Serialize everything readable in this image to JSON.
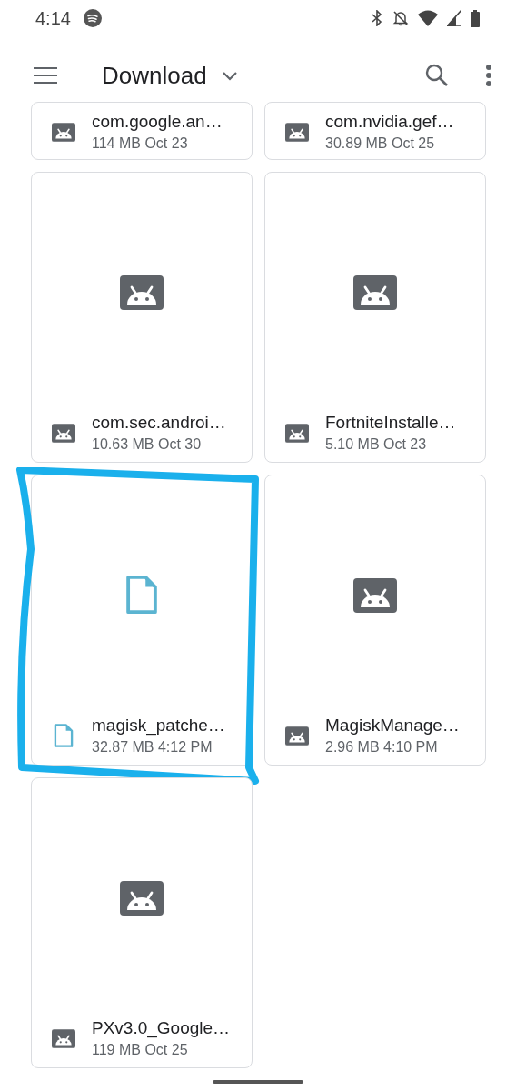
{
  "status_bar": {
    "time": "4:14"
  },
  "toolbar": {
    "title": "Download"
  },
  "files": [
    {
      "name": "com.google.an…",
      "details": "114 MB Oct 23",
      "kind": "apk",
      "thumbnail_visible": false,
      "highlighted": false
    },
    {
      "name": "com.nvidia.gef…",
      "details": "30.89 MB Oct 25",
      "kind": "apk",
      "thumbnail_visible": false,
      "highlighted": false
    },
    {
      "name": "com.sec.androi…",
      "details": "10.63 MB Oct 30",
      "kind": "apk",
      "thumbnail_visible": true,
      "highlighted": false
    },
    {
      "name": "FortniteInstalle…",
      "details": "5.10 MB Oct 23",
      "kind": "apk",
      "thumbnail_visible": true,
      "highlighted": false
    },
    {
      "name": "magisk_patche…",
      "details": "32.87 MB 4:12 PM",
      "kind": "document",
      "thumbnail_visible": true,
      "highlighted": true
    },
    {
      "name": "MagiskManage…",
      "details": "2.96 MB 4:10 PM",
      "kind": "apk",
      "thumbnail_visible": true,
      "highlighted": false
    },
    {
      "name": "PXv3.0_Google…",
      "details": "119 MB Oct 25",
      "kind": "apk",
      "thumbnail_visible": true,
      "highlighted": false
    }
  ]
}
